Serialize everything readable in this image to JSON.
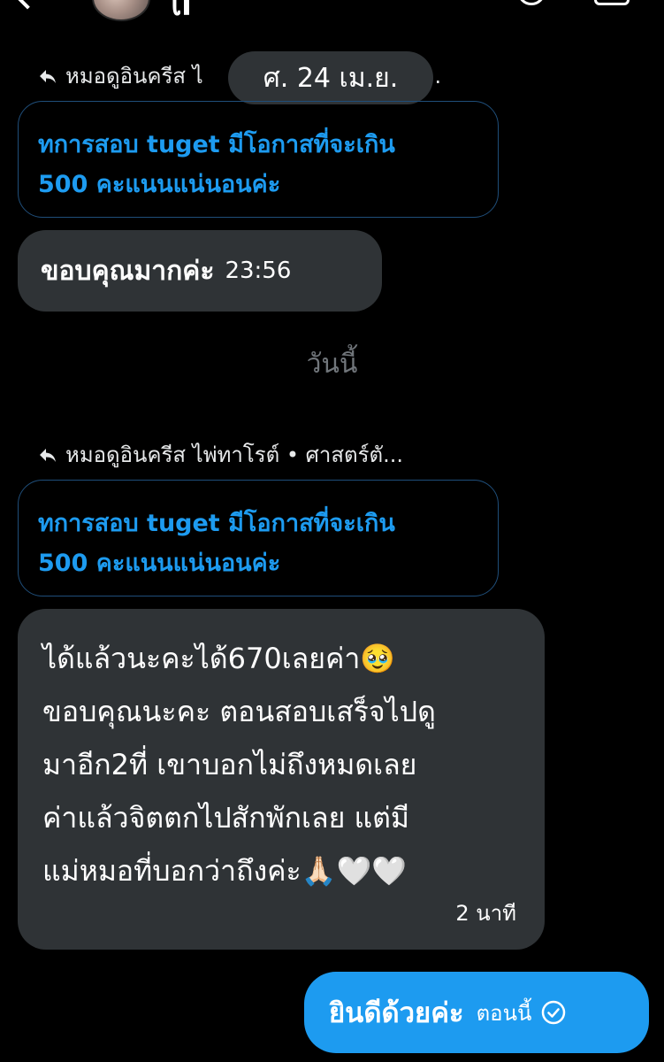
{
  "header": {
    "name": "ꪶl"
  },
  "date_pill": "ศ. 24 เม.ย.",
  "reply_refs": [
    {
      "text": "หมอดูอินครีส ไ",
      "tail": "ร์ตั..."
    },
    {
      "text": "หมอดูอินครีส ไพ่ทาโรต์ • ศาสตร์ตั..."
    }
  ],
  "quotes": [
    {
      "line1": "ทการสอบ tuget มีโอกาสที่จะเกิน",
      "line2": "500 คะแนนแน่นอนค่ะ"
    },
    {
      "line1": "ทการสอบ tuget มีโอกาสที่จะเกิน",
      "line2": "500 คะแนนแน่นอนค่ะ"
    }
  ],
  "messages": {
    "first": {
      "text": "ขอบคุณมากค่ะ",
      "time": "23:56"
    },
    "divider": "วันนี้",
    "second": {
      "text": "ได้แล้วนะคะได้670เลยค่า🥹\nขอบคุณนะคะ ตอนสอบเสร็จไปดู\nมาอีก2ที่ เขาบอกไม่ถึงหมดเลย\nค่าแล้วจิตตกไปสักพักเลย แต่มี\nแม่หมอที่บอกว่าถึงค่ะ🙏🏻🤍🤍",
      "time": "2 นาที"
    },
    "sent": {
      "text": "ยินดีด้วยค่ะ",
      "time": "ตอนนี้"
    }
  },
  "colors": {
    "background": "#000000",
    "bubble_grey": "#2f3336",
    "accent_blue": "#1d9bf0",
    "quote_border": "#1f4e7a",
    "muted": "#71767b"
  },
  "icons": {
    "reply": "reply-arrow-icon",
    "read_receipt": "check-circle-icon",
    "back": "chevron-left-icon"
  }
}
